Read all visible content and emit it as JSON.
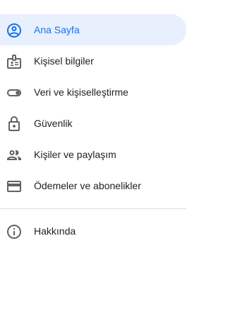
{
  "nav": {
    "items": [
      {
        "label": "Ana Sayfa",
        "icon": "account-circle-icon",
        "active": true
      },
      {
        "label": "Kişisel bilgiler",
        "icon": "id-card-icon"
      },
      {
        "label": "Veri ve kişiselleştirme",
        "icon": "toggle-icon"
      },
      {
        "label": "Güvenlik",
        "icon": "lock-icon"
      },
      {
        "label": "Kişiler ve paylaşım",
        "icon": "people-icon"
      },
      {
        "label": "Ödemeler ve abonelikler",
        "icon": "credit-card-icon"
      }
    ],
    "footer_items": [
      {
        "label": "Hakkında",
        "icon": "info-icon"
      }
    ]
  },
  "colors": {
    "accent": "#1a73e8",
    "active_bg": "#e8f0fe",
    "text": "#202124",
    "icon": "#5f6368",
    "divider": "#dadce0"
  }
}
